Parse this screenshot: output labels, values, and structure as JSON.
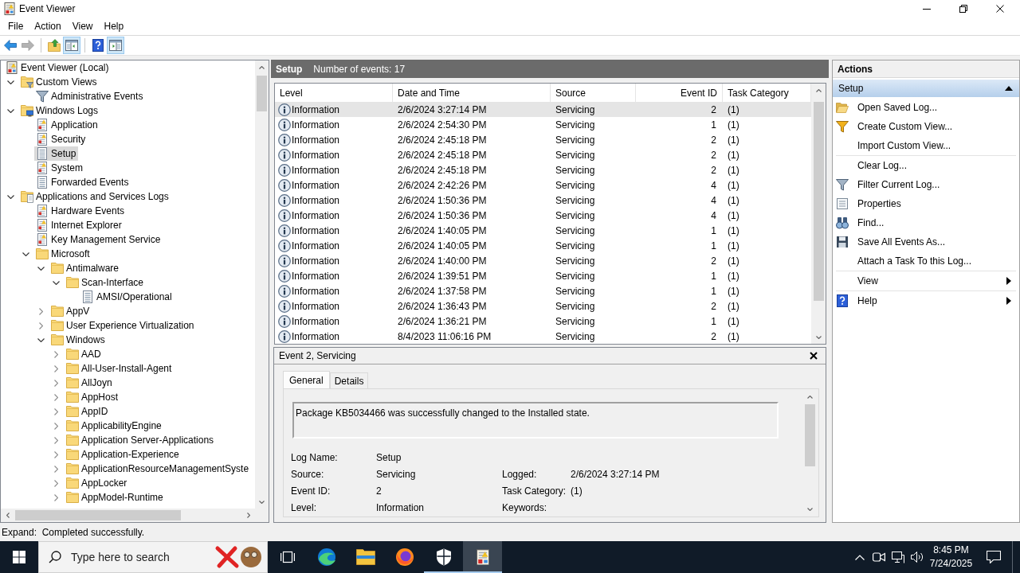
{
  "window": {
    "title": "Event Viewer"
  },
  "menu": [
    "File",
    "Action",
    "View",
    "Help"
  ],
  "toolbar": [
    [
      {
        "kind": "back",
        "disabled": false,
        "pressed": false
      },
      {
        "kind": "forward",
        "disabled": true,
        "pressed": false
      }
    ],
    [
      {
        "kind": "up",
        "disabled": false,
        "pressed": false
      },
      {
        "kind": "console_tree",
        "disabled": false,
        "pressed": true
      }
    ],
    [
      {
        "kind": "help",
        "disabled": false,
        "pressed": false
      },
      {
        "kind": "action_pane",
        "disabled": false,
        "pressed": true
      }
    ]
  ],
  "tree": [
    {
      "label": "Event Viewer (Local)",
      "kind": "root",
      "selected": false,
      "children": [
        {
          "label": "Custom Views",
          "kind": "views_folder",
          "expanded": true,
          "selected": false,
          "children": [
            {
              "label": "Administrative Events",
              "kind": "view",
              "selected": false
            }
          ]
        },
        {
          "label": "Windows Logs",
          "kind": "logs_folder",
          "expanded": true,
          "selected": false,
          "children": [
            {
              "label": "Application",
              "kind": "log",
              "selected": false
            },
            {
              "label": "Security",
              "kind": "log",
              "selected": false
            },
            {
              "label": "Setup",
              "kind": "channel",
              "selected": true
            },
            {
              "label": "System",
              "kind": "log",
              "selected": false
            },
            {
              "label": "Forwarded Events",
              "kind": "channel",
              "selected": false
            }
          ]
        },
        {
          "label": "Applications and Services Logs",
          "kind": "services_folder",
          "expanded": true,
          "selected": false,
          "children": [
            {
              "label": "Hardware Events",
              "kind": "log",
              "selected": false
            },
            {
              "label": "Internet Explorer",
              "kind": "log",
              "selected": false
            },
            {
              "label": "Key Management Service",
              "kind": "log",
              "selected": false
            },
            {
              "label": "Microsoft",
              "kind": "folder",
              "expanded": true,
              "selected": false,
              "children": [
                {
                  "label": "Antimalware",
                  "kind": "folder",
                  "expanded": true,
                  "selected": false,
                  "children": [
                    {
                      "label": "Scan-Interface",
                      "kind": "folder",
                      "expanded": true,
                      "selected": false,
                      "children": [
                        {
                          "label": "AMSI/Operational",
                          "kind": "channel",
                          "selected": false
                        }
                      ]
                    }
                  ]
                },
                {
                  "label": "AppV",
                  "kind": "folder",
                  "expanded": false,
                  "selected": false
                },
                {
                  "label": "User Experience Virtualization",
                  "kind": "folder",
                  "expanded": false,
                  "selected": false
                },
                {
                  "label": "Windows",
                  "kind": "folder",
                  "expanded": true,
                  "selected": false,
                  "children": [
                    {
                      "label": "AAD",
                      "kind": "folder",
                      "expanded": false,
                      "selected": false
                    },
                    {
                      "label": "All-User-Install-Agent",
                      "kind": "folder",
                      "expanded": false,
                      "selected": false
                    },
                    {
                      "label": "AllJoyn",
                      "kind": "folder",
                      "expanded": false,
                      "selected": false
                    },
                    {
                      "label": "AppHost",
                      "kind": "folder",
                      "expanded": false,
                      "selected": false
                    },
                    {
                      "label": "AppID",
                      "kind": "folder",
                      "expanded": false,
                      "selected": false
                    },
                    {
                      "label": "ApplicabilityEngine",
                      "kind": "folder",
                      "expanded": false,
                      "selected": false
                    },
                    {
                      "label": "Application Server-Applications",
                      "kind": "folder",
                      "expanded": false,
                      "selected": false
                    },
                    {
                      "label": "Application-Experience",
                      "kind": "folder",
                      "expanded": false,
                      "selected": false
                    },
                    {
                      "label": "ApplicationResourceManagementSyste",
                      "kind": "folder",
                      "expanded": false,
                      "selected": false
                    },
                    {
                      "label": "AppLocker",
                      "kind": "folder",
                      "expanded": false,
                      "selected": false
                    },
                    {
                      "label": "AppModel-Runtime",
                      "kind": "folder",
                      "expanded": false,
                      "selected": false
                    }
                  ]
                }
              ]
            }
          ]
        }
      ]
    }
  ],
  "events": {
    "log_name": "Setup",
    "count_label": "Number of events: 17",
    "columns": [
      "Level",
      "Date and Time",
      "Source",
      "Event ID",
      "Task Category"
    ],
    "rows": [
      {
        "level": "Information",
        "date_time": "2/6/2024 3:27:14 PM",
        "source": "Servicing",
        "event_id": "2",
        "task_category": "(1)",
        "selected": true
      },
      {
        "level": "Information",
        "date_time": "2/6/2024 2:54:30 PM",
        "source": "Servicing",
        "event_id": "1",
        "task_category": "(1)",
        "selected": false
      },
      {
        "level": "Information",
        "date_time": "2/6/2024 2:45:18 PM",
        "source": "Servicing",
        "event_id": "2",
        "task_category": "(1)",
        "selected": false
      },
      {
        "level": "Information",
        "date_time": "2/6/2024 2:45:18 PM",
        "source": "Servicing",
        "event_id": "2",
        "task_category": "(1)",
        "selected": false
      },
      {
        "level": "Information",
        "date_time": "2/6/2024 2:45:18 PM",
        "source": "Servicing",
        "event_id": "2",
        "task_category": "(1)",
        "selected": false
      },
      {
        "level": "Information",
        "date_time": "2/6/2024 2:42:26 PM",
        "source": "Servicing",
        "event_id": "4",
        "task_category": "(1)",
        "selected": false
      },
      {
        "level": "Information",
        "date_time": "2/6/2024 1:50:36 PM",
        "source": "Servicing",
        "event_id": "4",
        "task_category": "(1)",
        "selected": false
      },
      {
        "level": "Information",
        "date_time": "2/6/2024 1:50:36 PM",
        "source": "Servicing",
        "event_id": "4",
        "task_category": "(1)",
        "selected": false
      },
      {
        "level": "Information",
        "date_time": "2/6/2024 1:40:05 PM",
        "source": "Servicing",
        "event_id": "1",
        "task_category": "(1)",
        "selected": false
      },
      {
        "level": "Information",
        "date_time": "2/6/2024 1:40:05 PM",
        "source": "Servicing",
        "event_id": "1",
        "task_category": "(1)",
        "selected": false
      },
      {
        "level": "Information",
        "date_time": "2/6/2024 1:40:00 PM",
        "source": "Servicing",
        "event_id": "2",
        "task_category": "(1)",
        "selected": false
      },
      {
        "level": "Information",
        "date_time": "2/6/2024 1:39:51 PM",
        "source": "Servicing",
        "event_id": "1",
        "task_category": "(1)",
        "selected": false
      },
      {
        "level": "Information",
        "date_time": "2/6/2024 1:37:58 PM",
        "source": "Servicing",
        "event_id": "1",
        "task_category": "(1)",
        "selected": false
      },
      {
        "level": "Information",
        "date_time": "2/6/2024 1:36:43 PM",
        "source": "Servicing",
        "event_id": "2",
        "task_category": "(1)",
        "selected": false
      },
      {
        "level": "Information",
        "date_time": "2/6/2024 1:36:21 PM",
        "source": "Servicing",
        "event_id": "1",
        "task_category": "(1)",
        "selected": false
      },
      {
        "level": "Information",
        "date_time": "8/4/2023 11:06:16 PM",
        "source": "Servicing",
        "event_id": "2",
        "task_category": "(1)",
        "selected": false
      }
    ]
  },
  "detail": {
    "title": "Event 2, Servicing",
    "tabs": [
      {
        "label": "General",
        "selected": true
      },
      {
        "label": "Details",
        "selected": false
      }
    ],
    "message": "Package KB5034466 was successfully changed to the Installed state.",
    "fields": [
      {
        "left": {
          "label": "Log Name:",
          "value": "Setup"
        }
      },
      {
        "left": {
          "label": "Source:",
          "value": "Servicing"
        },
        "right": {
          "label": "Logged:",
          "value": "2/6/2024 3:27:14 PM"
        }
      },
      {
        "left": {
          "label": "Event ID:",
          "value": "2"
        },
        "right": {
          "label": "Task Category:",
          "value": "(1)"
        }
      },
      {
        "left": {
          "label": "Level:",
          "value": "Information"
        },
        "right": {
          "label": "Keywords:"
        }
      }
    ]
  },
  "actions": {
    "title": "Actions",
    "section": {
      "label": "Setup",
      "expanded": true
    },
    "groups": [
      [
        {
          "label": "Open Saved Log...",
          "kind": "open",
          "submenu": false
        },
        {
          "label": "Create Custom View...",
          "kind": "create",
          "submenu": false
        },
        {
          "label": "Import Custom View...",
          "kind": "import",
          "submenu": false
        }
      ],
      [
        {
          "label": "Clear Log...",
          "kind": "clear",
          "submenu": false
        },
        {
          "label": "Filter Current Log...",
          "kind": "filter",
          "submenu": false
        },
        {
          "label": "Properties",
          "kind": "properties",
          "submenu": false
        },
        {
          "label": "Find...",
          "kind": "find",
          "submenu": false
        },
        {
          "label": "Save All Events As...",
          "kind": "save",
          "submenu": false
        },
        {
          "label": "Attach a Task To this Log...",
          "kind": "attach",
          "submenu": false
        }
      ],
      [
        {
          "label": "View",
          "kind": "view",
          "submenu": true
        }
      ],
      [
        {
          "label": "Help",
          "kind": "help",
          "submenu": true
        }
      ]
    ]
  },
  "status_bar": {
    "text": "Expand:  Completed successfully."
  },
  "taskbar": {
    "search_placeholder": "Type here to search",
    "apps": [
      {
        "kind": "task_view",
        "running": false,
        "active": false
      },
      {
        "kind": "edge",
        "running": false,
        "active": false
      },
      {
        "kind": "explorer",
        "running": false,
        "active": false
      },
      {
        "kind": "firefox",
        "running": false,
        "active": false
      },
      {
        "kind": "security",
        "running": true,
        "active": false
      },
      {
        "kind": "event_viewer",
        "running": true,
        "active": true
      }
    ],
    "clock": {
      "time": "8:45 PM",
      "date": "7/24/2025"
    }
  }
}
